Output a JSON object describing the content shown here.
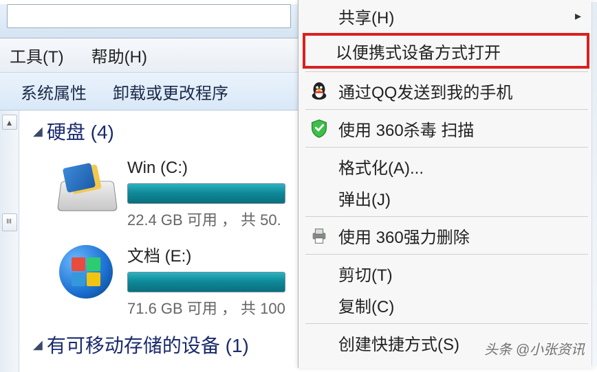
{
  "menu": {
    "tools": "工具(T)",
    "help": "帮助(H)"
  },
  "toolbar": {
    "system_properties": "系统属性",
    "uninstall_change": "卸载或更改程序"
  },
  "sections": {
    "drives_label": "硬盘 (4)",
    "removable_label": "有可移动存储的设备 (1)"
  },
  "drives": [
    {
      "name": "Win (C:)",
      "free_text": "22.4 GB 可用 ， 共 50.",
      "fill_pct": 100
    },
    {
      "name": "文档 (E:)",
      "free_text": "71.6 GB 可用 ， 共 100",
      "fill_pct": 100
    }
  ],
  "context_menu": {
    "share": "共享(H)",
    "open_portable": "以便携式设备方式打开",
    "send_qq": "通过QQ发送到我的手机",
    "scan_360": "使用 360杀毒 扫描",
    "format": "格式化(A)...",
    "eject": "弹出(J)",
    "force_delete_360": "使用 360强力删除",
    "cut": "剪切(T)",
    "copy": "复制(C)",
    "create_shortcut": "创建快捷方式(S)"
  },
  "scroll": {
    "up_glyph": "▴",
    "handle_glyph": "≡"
  },
  "watermark": "头条 @小张资讯"
}
